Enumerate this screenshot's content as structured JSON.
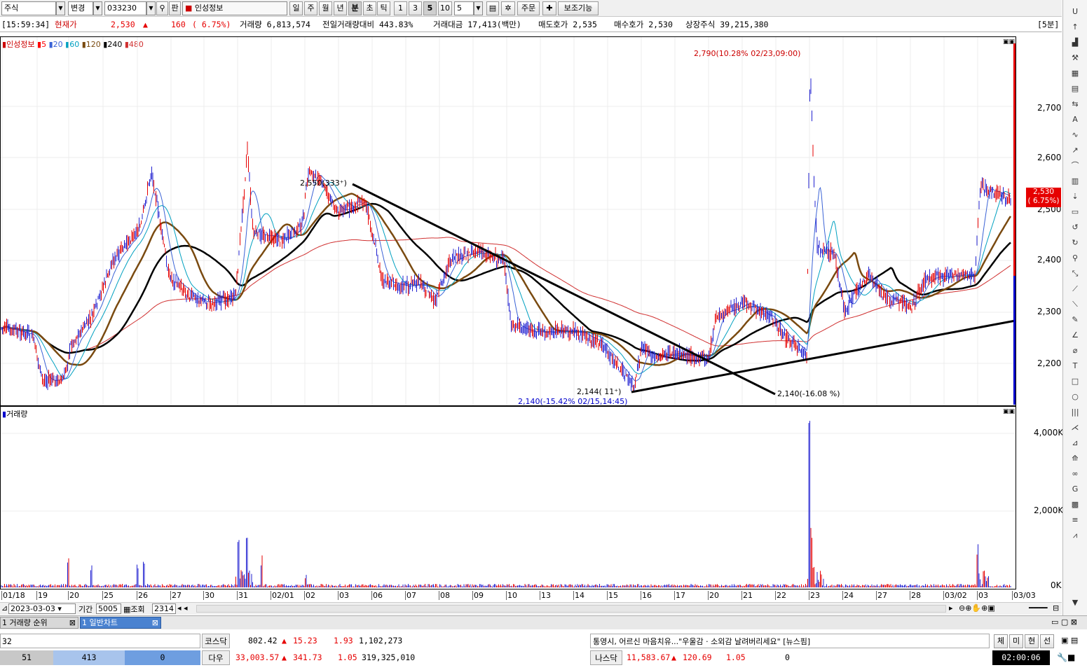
{
  "toolbar": {
    "market": "주식",
    "change": "변경",
    "code": "033230",
    "pan": "판",
    "name": "인성정보",
    "periods": [
      "일",
      "주",
      "월",
      "년",
      "분",
      "초",
      "틱"
    ],
    "active_period": "분",
    "minutes": [
      "1",
      "3",
      "5",
      "10"
    ],
    "active_minute": "5",
    "minute_value": "5",
    "order": "주문",
    "aux": "보조기능"
  },
  "info": {
    "time": "[15:59:34]",
    "price_label": "현재가",
    "price": "2,530",
    "arrow": "▲",
    "change": "160",
    "change_pct": "( 6.75%)",
    "volume": "거래량 6,813,574",
    "prev_volume": "전일거래량대비 443.83%",
    "amount": "거래대금 17,413(백만)",
    "ask": "매도호가 2,535",
    "bid": "매수호가 2,530",
    "shares": "상장주식 39,215,380",
    "interval": "[5분]"
  },
  "price_panel": {
    "legend_name": "인성정보",
    "ma": [
      "5",
      "20",
      "60",
      "120",
      "240",
      "480"
    ],
    "y_ticks": [
      "2,700",
      "2,600",
      "2,500",
      "2,400",
      "2,300",
      "2,200"
    ],
    "current_tag": "2,530",
    "current_pct": "( 6.75%)",
    "annotations": {
      "high": "2,790(10.28% 02/23,09:00)",
      "peak_left": "2,550(333⁺)",
      "low_count": "2,144( 11⁺)",
      "low": "2,140(-15.42% 02/15,14:45)",
      "trend_end": "2,140(-16.08 %)"
    }
  },
  "volume_panel": {
    "legend": "거래량",
    "y_ticks": [
      "4,000K",
      "2,000K",
      "0K"
    ]
  },
  "x_axis": [
    "01/18",
    "19",
    "20",
    "25",
    "26",
    "27",
    "30",
    "31",
    "02/01",
    "02",
    "03",
    "06",
    "07",
    "08",
    "09",
    "10",
    "13",
    "14",
    "15",
    "16",
    "17",
    "20",
    "21",
    "22",
    "23",
    "24",
    "27",
    "28",
    "03/02",
    "03",
    "03/03"
  ],
  "controls": {
    "date": "2023-03-03",
    "period_label": "기간",
    "period": "5005",
    "query": "조회",
    "count": "2314"
  },
  "tabs": [
    "거래량 순위",
    "일반차트"
  ],
  "ticker": {
    "row1": {
      "left": "32",
      "index": "코스닥",
      "value": "802.42",
      "arrow": "▲",
      "chg": "15.23",
      "pct": "1.93",
      "vol": "1,102,273",
      "news": "통영시, 어르신 마음치유...\"우울감 · 소외감 날려버리세요\" [뉴스핌]"
    },
    "row2": {
      "c1": "51",
      "c2": "413",
      "c3": "0",
      "index": "다우",
      "value": "33,003.57",
      "arrow": "▲",
      "chg": "341.73",
      "pct": "1.05",
      "vol": "319,325,010",
      "index2": "나스닥",
      "value2": "11,583.67",
      "arrow2": "▲",
      "chg2": "120.69",
      "pct2": "1.05",
      "vol2": "0",
      "clock": "02:00:06"
    },
    "buttons": [
      "체",
      "미",
      "현",
      "선"
    ]
  },
  "colors": {
    "up": "#e60000",
    "down": "#0000cc",
    "ma5": "#ff0000",
    "ma20": "#3b63d6",
    "ma60": "#00a0c0",
    "ma120": "#7a4a10",
    "ma240": "#000000",
    "ma480": "#d03030"
  }
}
